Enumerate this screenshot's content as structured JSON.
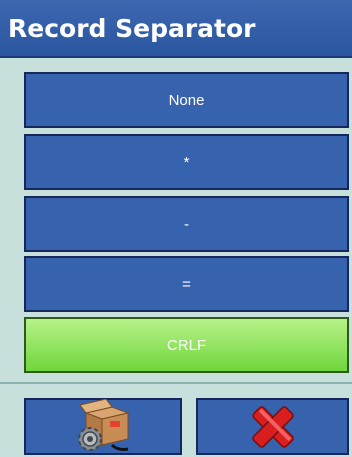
{
  "header": {
    "title": "Record Separator"
  },
  "options": [
    {
      "label": "None",
      "selected": false
    },
    {
      "label": "*",
      "selected": false
    },
    {
      "label": "-",
      "selected": false
    },
    {
      "label": "=",
      "selected": false
    },
    {
      "label": "CRLF",
      "selected": true
    }
  ],
  "footer": {
    "setup_icon": "box-gear-icon",
    "cancel_icon": "red-x-icon"
  },
  "colors": {
    "title_bar": "#2f5ba6",
    "option_bg": "#3762ad",
    "selected_bg": "#80dd48",
    "background": "#c8e0dc",
    "cancel_red": "#d81e1e"
  }
}
